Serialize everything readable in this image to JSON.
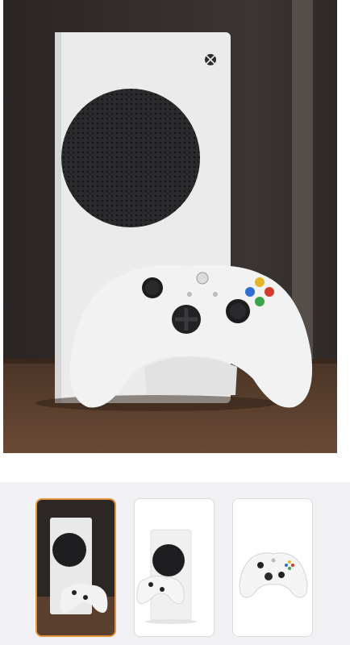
{
  "product_gallery": {
    "main_image": {
      "subject": "xbox-series-s-console-with-controller",
      "scene": "dark-room-wooden-table"
    },
    "thumbnails": [
      {
        "subject": "console-and-controller-on-table",
        "selected": true
      },
      {
        "subject": "console-and-controller-white-background",
        "selected": false
      },
      {
        "subject": "controller-only-white-background",
        "selected": false
      }
    ],
    "colors": {
      "selected_border": "#e0933a",
      "thumb_border": "#d9d9de",
      "gallery_background": "#f1f1f3"
    }
  }
}
